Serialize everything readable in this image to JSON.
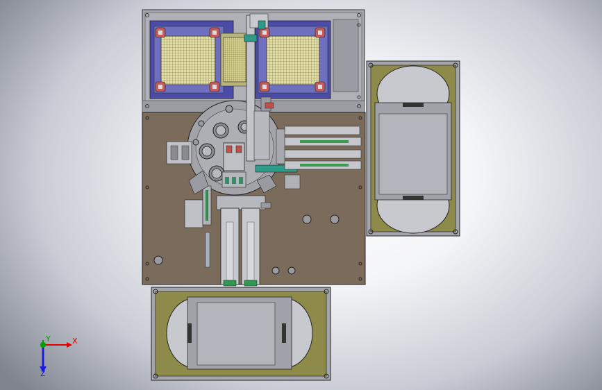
{
  "viewport": {
    "triad": {
      "x_label": "X",
      "y_label": "Y",
      "z_label": "Z"
    }
  },
  "colors": {
    "background_center": "#ffffff",
    "background_edge": "#7f848f",
    "deck_plate": "#7a6a58",
    "frame_grey": "#a8a8ae",
    "tray_blue": "#4a4aa6",
    "tray_mesh": "#d8d39a",
    "reel_olive": "#8e8a48",
    "accent_green": "#2e9a8a",
    "accent_red": "#c0504a",
    "axis_x": "#e00000",
    "axis_y": "#00a000",
    "axis_z": "#1a1ae0"
  }
}
